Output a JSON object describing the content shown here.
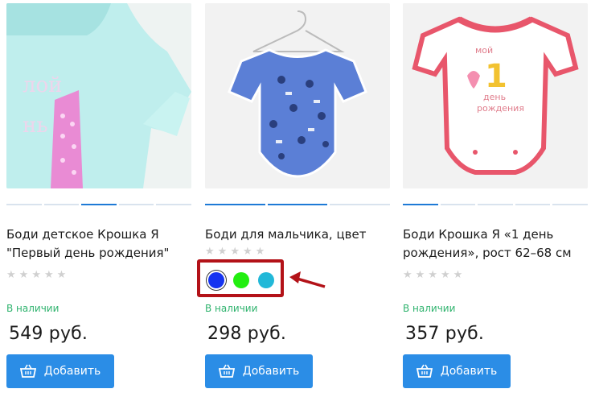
{
  "products": [
    {
      "title": "Боди детское Крошка Я \"Первый день рождения\"",
      "stock": "В наличии",
      "price": "549 руб.",
      "add_label": "Добавить",
      "rating_stars": 5
    },
    {
      "title": "Боди для мальчика, цвет",
      "stock": "В наличии",
      "price": "298 руб.",
      "add_label": "Добавить",
      "rating_stars": 5,
      "swatches": [
        "#1533f0",
        "#22ee10",
        "#22b8d8"
      ]
    },
    {
      "title": "Боди Крошка Я «1 день рождения», рост 62–68 см",
      "stock": "В наличии",
      "price": "357 руб.",
      "add_label": "Добавить",
      "rating_stars": 5
    }
  ],
  "colors": {
    "accent": "#2b8de6",
    "stock": "#2fb36e",
    "highlight": "#b31218"
  },
  "icons": {
    "cart": "basket-icon",
    "star": "star-icon"
  }
}
